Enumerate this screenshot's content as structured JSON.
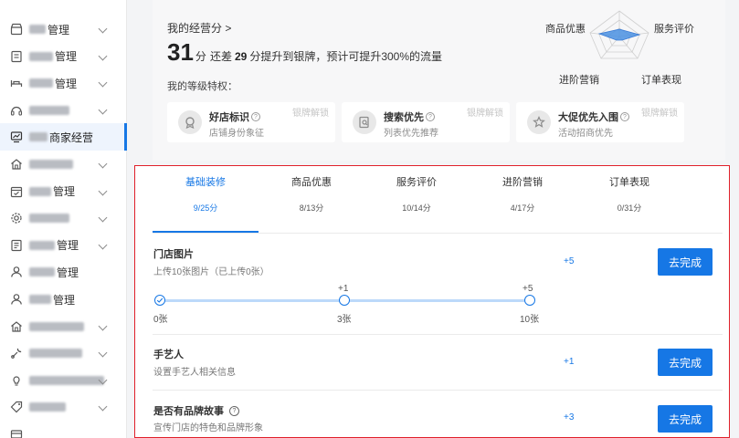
{
  "sidebar": {
    "items": [
      {
        "prefix": "",
        "label": "管理",
        "icon": "store-icon",
        "chevron": true,
        "active": false
      },
      {
        "prefix": "",
        "label": "管理",
        "icon": "document-icon",
        "chevron": true,
        "active": false
      },
      {
        "prefix": "",
        "label": "管理",
        "icon": "bed-icon",
        "chevron": true,
        "active": false
      },
      {
        "prefix": "",
        "label": "",
        "icon": "headset-icon",
        "chevron": true,
        "active": false
      },
      {
        "prefix": "",
        "label": "商家经营",
        "icon": "chart-icon",
        "chevron": false,
        "active": true
      },
      {
        "prefix": "",
        "label": "",
        "icon": "home-icon",
        "chevron": true,
        "active": false
      },
      {
        "prefix": "",
        "label": "管理",
        "icon": "calendar-icon",
        "chevron": true,
        "active": false
      },
      {
        "prefix": "",
        "label": "",
        "icon": "gear-icon",
        "chevron": true,
        "active": false
      },
      {
        "prefix": "",
        "label": "管理",
        "icon": "file-list-icon",
        "chevron": true,
        "active": false
      },
      {
        "prefix": "",
        "label": "管理",
        "icon": "user-icon",
        "chevron": false,
        "active": false
      },
      {
        "prefix": "",
        "label": "管理",
        "icon": "user-icon",
        "chevron": false,
        "active": false
      },
      {
        "prefix": "",
        "label": "",
        "icon": "home-icon",
        "chevron": true,
        "active": false
      },
      {
        "prefix": "",
        "label": "",
        "icon": "wrench-icon",
        "chevron": true,
        "active": false
      },
      {
        "prefix": "",
        "label": "",
        "icon": "bulb-icon",
        "chevron": true,
        "active": false
      },
      {
        "prefix": "",
        "label": "",
        "icon": "tag-icon",
        "chevron": true,
        "active": false
      },
      {
        "prefix": "",
        "label": "",
        "icon": "card-icon",
        "chevron": false,
        "active": false
      }
    ]
  },
  "overview": {
    "score_link": "我的经营分 >",
    "score": "31",
    "unit": "分",
    "text_a": "还差",
    "gap": "29",
    "text_b": "分提升到银牌，预计可提升300%的流量",
    "privileges_title": "我的等级特权："
  },
  "privileges": [
    {
      "name": "好店标识",
      "desc": "店铺身份象征",
      "lock": "银牌解锁",
      "icon": "badge-icon"
    },
    {
      "name": "搜索优先",
      "desc": "列表优先推荐",
      "lock": "银牌解锁",
      "icon": "search-doc-icon"
    },
    {
      "name": "大促优先入围",
      "desc": "活动招商优先",
      "lock": "银牌解锁",
      "icon": "star-icon"
    }
  ],
  "radar": {
    "labels": [
      "商品优惠",
      "服务评价",
      "进阶营销",
      "订单表现"
    ],
    "fill": "#4a90e2"
  },
  "tabs": [
    {
      "name": "基础装修",
      "score": "9/25分",
      "active": true
    },
    {
      "name": "商品优惠",
      "score": "8/13分",
      "active": false
    },
    {
      "name": "服务评价",
      "score": "10/14分",
      "active": false
    },
    {
      "name": "进阶营销",
      "score": "4/17分",
      "active": false
    },
    {
      "name": "订单表现",
      "score": "0/31分",
      "active": false
    }
  ],
  "tasks": [
    {
      "title": "门店图片",
      "desc": "上传10张图片（已上传0张）",
      "points": "+5",
      "button": "去完成",
      "help": false
    },
    {
      "title": "手艺人",
      "desc": "设置手艺人相关信息",
      "points": "+1",
      "button": "去完成",
      "help": false
    },
    {
      "title": "是否有品牌故事",
      "desc": "宣传门店的特色和品牌形象",
      "points": "+3",
      "button": "去完成",
      "help": true
    }
  ],
  "progress": {
    "nodes": [
      {
        "above": "",
        "below": "0张",
        "done": true
      },
      {
        "above": "+1",
        "below": "3张",
        "done": false
      },
      {
        "above": "+5",
        "below": "10张",
        "done": false
      }
    ]
  },
  "colors": {
    "accent": "#1677e5",
    "highlight_border": "#e0202a"
  }
}
